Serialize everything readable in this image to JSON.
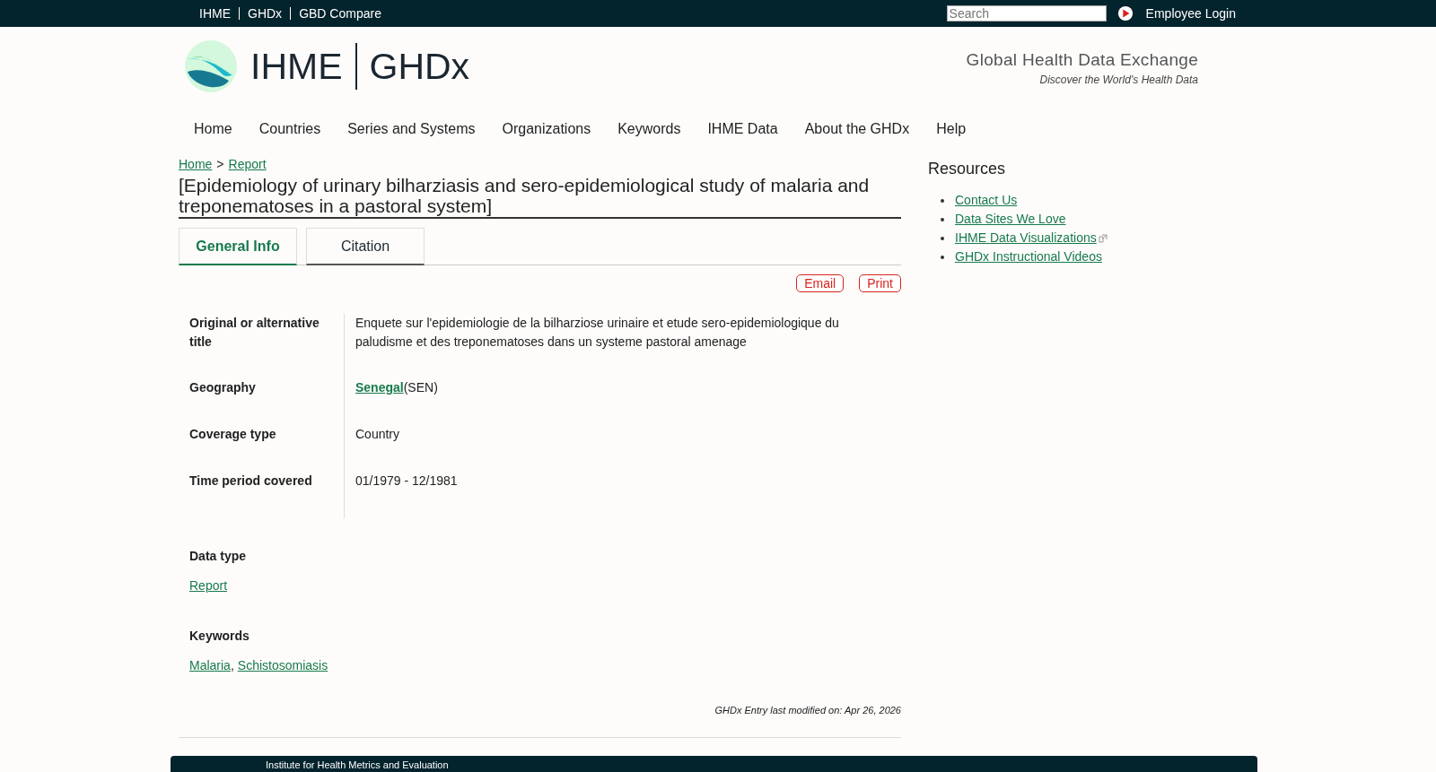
{
  "top_bar": {
    "links": [
      "IHME",
      "GHDx",
      "GBD Compare"
    ],
    "search": {
      "placeholder": "Search"
    },
    "login": "Employee Login"
  },
  "header": {
    "logo_left": "IHME",
    "logo_right": "GHDx",
    "tagline_title": "Global Health Data Exchange",
    "tagline_sub": "Discover the World’s Health Data"
  },
  "nav": [
    "Home",
    "Countries",
    "Series and Systems",
    "Organizations",
    "Keywords",
    "IHME Data",
    "About the GHDx",
    "Help"
  ],
  "breadcrumb": {
    "items": [
      "Home",
      "Report"
    ],
    "separator": ">"
  },
  "title": "[Epidemiology of urinary bilharziasis and sero-epidemiological study of malaria and treponematoses in a pastoral system]",
  "tabs": [
    {
      "label": "General Info",
      "selected": true
    },
    {
      "label": "Citation",
      "selected": false
    }
  ],
  "actions": [
    "Email",
    "Print"
  ],
  "fields": [
    {
      "label": "Original or alternative title",
      "kind": "text",
      "value": "Enquete sur l'epidemiologie de la bilharziose urinaire et etude sero-epidemiologique du paludisme et des treponematoses dans un systeme pastoral amenage"
    },
    {
      "label": "Geography",
      "kind": "link",
      "link": "Senegal",
      "value": "(SEN)"
    },
    {
      "label": "Coverage type",
      "kind": "text",
      "value": "Country"
    },
    {
      "label": "Time period covered",
      "kind": "text",
      "value": "01/1979 - 12/1981"
    }
  ],
  "data_type": {
    "label": "Data type",
    "links": [
      "Report"
    ]
  },
  "keywords": {
    "label": "Keywords",
    "links": [
      "Malaria",
      "Schistosomiasis"
    ],
    "separator": ","
  },
  "modified": "GHDx Entry last modified on: Apr 26, 2026",
  "sidebar": {
    "title": "Resources",
    "links": [
      {
        "label": "Contact Us",
        "external": false
      },
      {
        "label": "Data Sites We Love",
        "external": false
      },
      {
        "label": "IHME Data Visualizations",
        "external": true
      },
      {
        "label": "GHDx Instructional Videos",
        "external": false
      }
    ]
  },
  "footer": {
    "text": "Institute for Health Metrics and Evaluation"
  }
}
